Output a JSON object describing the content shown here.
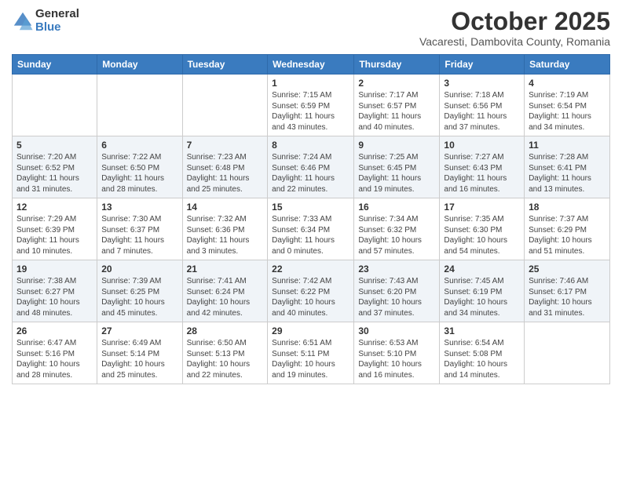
{
  "logo": {
    "general": "General",
    "blue": "Blue"
  },
  "header": {
    "month": "October 2025",
    "location": "Vacaresti, Dambovita County, Romania"
  },
  "days_of_week": [
    "Sunday",
    "Monday",
    "Tuesday",
    "Wednesday",
    "Thursday",
    "Friday",
    "Saturday"
  ],
  "weeks": [
    [
      {
        "day": "",
        "info": ""
      },
      {
        "day": "",
        "info": ""
      },
      {
        "day": "",
        "info": ""
      },
      {
        "day": "1",
        "info": "Sunrise: 7:15 AM\nSunset: 6:59 PM\nDaylight: 11 hours and 43 minutes."
      },
      {
        "day": "2",
        "info": "Sunrise: 7:17 AM\nSunset: 6:57 PM\nDaylight: 11 hours and 40 minutes."
      },
      {
        "day": "3",
        "info": "Sunrise: 7:18 AM\nSunset: 6:56 PM\nDaylight: 11 hours and 37 minutes."
      },
      {
        "day": "4",
        "info": "Sunrise: 7:19 AM\nSunset: 6:54 PM\nDaylight: 11 hours and 34 minutes."
      }
    ],
    [
      {
        "day": "5",
        "info": "Sunrise: 7:20 AM\nSunset: 6:52 PM\nDaylight: 11 hours and 31 minutes."
      },
      {
        "day": "6",
        "info": "Sunrise: 7:22 AM\nSunset: 6:50 PM\nDaylight: 11 hours and 28 minutes."
      },
      {
        "day": "7",
        "info": "Sunrise: 7:23 AM\nSunset: 6:48 PM\nDaylight: 11 hours and 25 minutes."
      },
      {
        "day": "8",
        "info": "Sunrise: 7:24 AM\nSunset: 6:46 PM\nDaylight: 11 hours and 22 minutes."
      },
      {
        "day": "9",
        "info": "Sunrise: 7:25 AM\nSunset: 6:45 PM\nDaylight: 11 hours and 19 minutes."
      },
      {
        "day": "10",
        "info": "Sunrise: 7:27 AM\nSunset: 6:43 PM\nDaylight: 11 hours and 16 minutes."
      },
      {
        "day": "11",
        "info": "Sunrise: 7:28 AM\nSunset: 6:41 PM\nDaylight: 11 hours and 13 minutes."
      }
    ],
    [
      {
        "day": "12",
        "info": "Sunrise: 7:29 AM\nSunset: 6:39 PM\nDaylight: 11 hours and 10 minutes."
      },
      {
        "day": "13",
        "info": "Sunrise: 7:30 AM\nSunset: 6:37 PM\nDaylight: 11 hours and 7 minutes."
      },
      {
        "day": "14",
        "info": "Sunrise: 7:32 AM\nSunset: 6:36 PM\nDaylight: 11 hours and 3 minutes."
      },
      {
        "day": "15",
        "info": "Sunrise: 7:33 AM\nSunset: 6:34 PM\nDaylight: 11 hours and 0 minutes."
      },
      {
        "day": "16",
        "info": "Sunrise: 7:34 AM\nSunset: 6:32 PM\nDaylight: 10 hours and 57 minutes."
      },
      {
        "day": "17",
        "info": "Sunrise: 7:35 AM\nSunset: 6:30 PM\nDaylight: 10 hours and 54 minutes."
      },
      {
        "day": "18",
        "info": "Sunrise: 7:37 AM\nSunset: 6:29 PM\nDaylight: 10 hours and 51 minutes."
      }
    ],
    [
      {
        "day": "19",
        "info": "Sunrise: 7:38 AM\nSunset: 6:27 PM\nDaylight: 10 hours and 48 minutes."
      },
      {
        "day": "20",
        "info": "Sunrise: 7:39 AM\nSunset: 6:25 PM\nDaylight: 10 hours and 45 minutes."
      },
      {
        "day": "21",
        "info": "Sunrise: 7:41 AM\nSunset: 6:24 PM\nDaylight: 10 hours and 42 minutes."
      },
      {
        "day": "22",
        "info": "Sunrise: 7:42 AM\nSunset: 6:22 PM\nDaylight: 10 hours and 40 minutes."
      },
      {
        "day": "23",
        "info": "Sunrise: 7:43 AM\nSunset: 6:20 PM\nDaylight: 10 hours and 37 minutes."
      },
      {
        "day": "24",
        "info": "Sunrise: 7:45 AM\nSunset: 6:19 PM\nDaylight: 10 hours and 34 minutes."
      },
      {
        "day": "25",
        "info": "Sunrise: 7:46 AM\nSunset: 6:17 PM\nDaylight: 10 hours and 31 minutes."
      }
    ],
    [
      {
        "day": "26",
        "info": "Sunrise: 6:47 AM\nSunset: 5:16 PM\nDaylight: 10 hours and 28 minutes."
      },
      {
        "day": "27",
        "info": "Sunrise: 6:49 AM\nSunset: 5:14 PM\nDaylight: 10 hours and 25 minutes."
      },
      {
        "day": "28",
        "info": "Sunrise: 6:50 AM\nSunset: 5:13 PM\nDaylight: 10 hours and 22 minutes."
      },
      {
        "day": "29",
        "info": "Sunrise: 6:51 AM\nSunset: 5:11 PM\nDaylight: 10 hours and 19 minutes."
      },
      {
        "day": "30",
        "info": "Sunrise: 6:53 AM\nSunset: 5:10 PM\nDaylight: 10 hours and 16 minutes."
      },
      {
        "day": "31",
        "info": "Sunrise: 6:54 AM\nSunset: 5:08 PM\nDaylight: 10 hours and 14 minutes."
      },
      {
        "day": "",
        "info": ""
      }
    ]
  ]
}
